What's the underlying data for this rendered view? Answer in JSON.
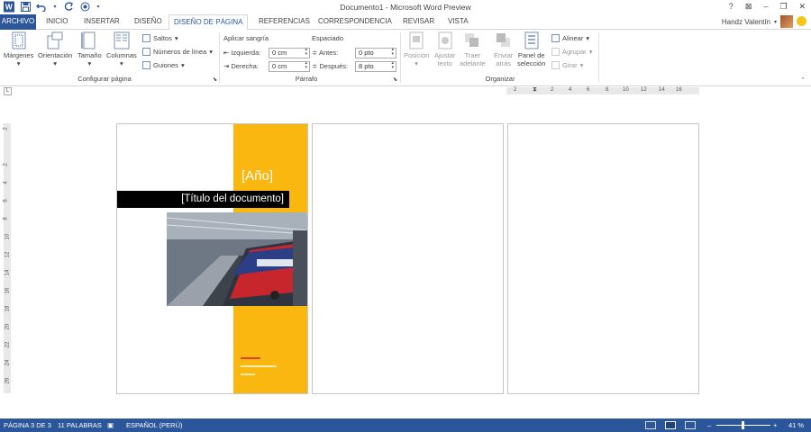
{
  "window": {
    "title": "Documento1 - Microsoft Word Preview",
    "controls": [
      "?",
      "⊠",
      "–",
      "❐",
      "✕"
    ]
  },
  "tabs": [
    {
      "label": "ARCHIVO"
    },
    {
      "label": "INICIO"
    },
    {
      "label": "INSERTAR"
    },
    {
      "label": "DISEÑO"
    },
    {
      "label": "DISEÑO DE PÁGINA"
    },
    {
      "label": "REFERENCIAS"
    },
    {
      "label": "CORRESPONDENCIA"
    },
    {
      "label": "REVISAR"
    },
    {
      "label": "VISTA"
    }
  ],
  "user": {
    "name": "Handz Valentín"
  },
  "ribbon": {
    "configurar": {
      "label": "Configurar página",
      "margenes": "Márgenes",
      "orientacion": "Orientación",
      "tamano": "Tamaño",
      "columnas": "Columnas",
      "saltos": "Saltos",
      "numeros": "Números de línea",
      "guiones": "Guiones"
    },
    "parrafo": {
      "label": "Párrafo",
      "aplicar_sangria": "Aplicar sangría",
      "izquierda_label": "Izquierda:",
      "izquierda_value": "0 cm",
      "derecha_label": "Derecha:",
      "derecha_value": "0 cm",
      "espaciado": "Espaciado",
      "antes_label": "Antes:",
      "antes_value": "0 pto",
      "despues_label": "Después:",
      "despues_value": "8 pto"
    },
    "organizar": {
      "label": "Organizar",
      "posicion": "Posición",
      "ajustar_1": "Ajustar",
      "ajustar_2": "texto",
      "traer_1": "Traer",
      "traer_2": "adelante",
      "enviar_1": "Enviar",
      "enviar_2": "atrás",
      "panel_1": "Panel de",
      "panel_2": "selección",
      "alinear": "Alinear",
      "agrupar": "Agrupar",
      "girar": "Girar"
    }
  },
  "ruler": {
    "h_ticks": [
      "2",
      "2",
      "4",
      "6",
      "8",
      "10",
      "12",
      "14",
      "16"
    ],
    "v_ticks": [
      "2",
      "2",
      "4",
      "6",
      "8",
      "10",
      "12",
      "14",
      "16",
      "18",
      "20",
      "22",
      "24",
      "26"
    ]
  },
  "document": {
    "year": "[Año]",
    "doc_title": "[Título del documento]"
  },
  "status": {
    "page": "PÁGINA 3 DE 3",
    "words": "11 PALABRAS",
    "language": "ESPAÑOL (PERÚ)",
    "zoom_percent": "41 %",
    "zoom_minus": "–",
    "zoom_plus": "+"
  },
  "colors": {
    "accent": "#2b579a",
    "cover_band": "#f9b70f"
  }
}
